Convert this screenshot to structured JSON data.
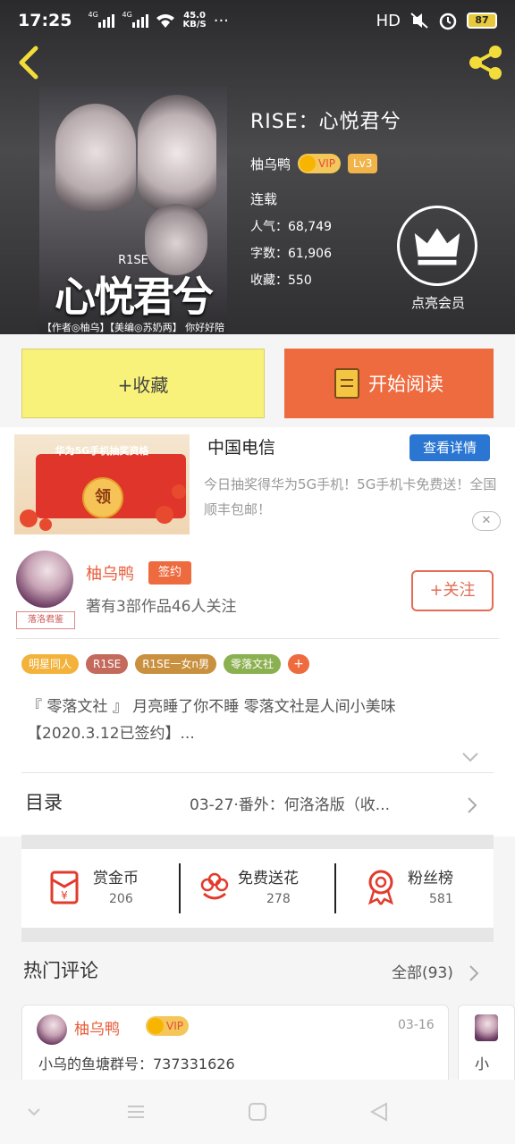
{
  "status_bar": {
    "time": "17:25",
    "net1": "4G",
    "net2": "4G",
    "speed_value": "45.0",
    "speed_unit": "KB/S",
    "more": "···",
    "hd": "HD",
    "battery": "87"
  },
  "book": {
    "title": "RISE：心悦君兮",
    "author": "柚乌鸭",
    "vip_label": "VIP",
    "level": "Lv3",
    "status": "连载",
    "popularity": "人气：68,749",
    "word_count": "字数：61,906",
    "favorites": "收藏：550",
    "member_label": "点亮会员",
    "cover": {
      "band": "R1SE",
      "title": "心悦君兮",
      "caption": "【作者◎柚乌】【美编◎苏奶两】 你好好陪她，我四海为家"
    }
  },
  "actions": {
    "favorite_label": "+收藏",
    "read_label": "开始阅读"
  },
  "ad": {
    "image_text": "华为5G手机抽奖资格",
    "coin_text": "领",
    "brand": "中国电信",
    "detail_label": "查看详情",
    "description": "今日抽奖得华为5G手机！5G手机卡免费送！全国顺丰包邮！",
    "close_label": "✕"
  },
  "author_section": {
    "name": "柚乌鸭",
    "sign_badge": "签约",
    "avatar_tag": "落洛君鉴",
    "meta": "著有3部作品46人关注",
    "follow_label": "+关注",
    "tags": [
      {
        "label": "明星同人",
        "color": "#f3b23b"
      },
      {
        "label": "R1SE",
        "color": "#c46a5c"
      },
      {
        "label": "R1SE一女n男",
        "color": "#c9913f"
      },
      {
        "label": "零落文社",
        "color": "#8bb04f"
      }
    ],
    "tag_more": "+",
    "intro": "『 零落文社 』 月亮睡了你不睡 零落文社是人间小美味 【2020.3.12已签约】...",
    "toc_label": "目录",
    "toc_latest": "03-27·番外：何洛洛版（收..."
  },
  "stats": [
    {
      "label": "赏金币",
      "value": "206",
      "icon": "red-envelope-icon"
    },
    {
      "label": "免费送花",
      "value": "278",
      "icon": "flower-icon"
    },
    {
      "label": "粉丝榜",
      "value": "581",
      "icon": "medal-icon"
    }
  ],
  "comments": {
    "title": "热门评论",
    "all_label": "全部(93)",
    "items": [
      {
        "user": "柚乌鸭",
        "vip": "VIP",
        "date": "03-16",
        "text": "小乌的鱼塘群号：737331626"
      }
    ],
    "next_peek": "小"
  },
  "colors": {
    "accent_orange": "#ee6b3f",
    "favorite_yellow": "#f8f27a",
    "detail_blue": "#2a76d2",
    "name_red": "#e85c3a"
  }
}
